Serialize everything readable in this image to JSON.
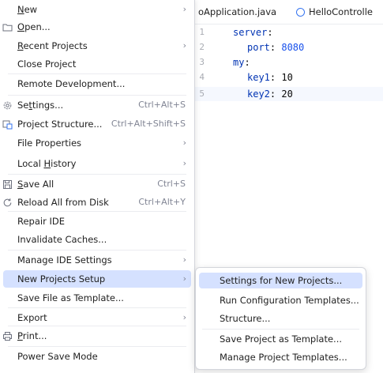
{
  "editor": {
    "tabs": [
      {
        "label": "oApplication.java"
      },
      {
        "label": "HelloControlle"
      }
    ],
    "line_numbers": [
      "1",
      "2",
      "3",
      "4",
      "5"
    ],
    "code": [
      {
        "key": "server",
        "punct": ":",
        "value": ""
      },
      {
        "key": "port",
        "punct": ": ",
        "value": "8080"
      },
      {
        "key": "my",
        "punct": ":",
        "value": ""
      },
      {
        "key": "key1",
        "punct": ": ",
        "value": "10"
      },
      {
        "key": "key2",
        "punct": ": ",
        "value": "20"
      }
    ]
  },
  "menu": {
    "items": [
      {
        "label": "New",
        "underline": "N",
        "shortcut": "",
        "submenu": true,
        "icon": ""
      },
      {
        "label": "Open...",
        "underline": "O",
        "shortcut": "",
        "submenu": false,
        "icon": "folder-icon"
      },
      {
        "label": "Recent Projects",
        "underline": "R",
        "shortcut": "",
        "submenu": true,
        "icon": ""
      },
      {
        "label": "Close Project",
        "underline": "",
        "shortcut": "",
        "submenu": false,
        "icon": ""
      },
      {
        "label": "Remote Development...",
        "underline": "",
        "shortcut": "",
        "submenu": false,
        "icon": ""
      },
      {
        "label": "Settings...",
        "underline": "t",
        "shortcut": "Ctrl+Alt+S",
        "submenu": false,
        "icon": "gear-icon"
      },
      {
        "label": "Project Structure...",
        "underline": "",
        "shortcut": "Ctrl+Alt+Shift+S",
        "submenu": false,
        "icon": "project-structure-icon"
      },
      {
        "label": "File Properties",
        "underline": "",
        "shortcut": "",
        "submenu": true,
        "icon": ""
      },
      {
        "label": "Local History",
        "underline": "H",
        "shortcut": "",
        "submenu": true,
        "icon": ""
      },
      {
        "label": "Save All",
        "underline": "S",
        "shortcut": "Ctrl+S",
        "submenu": false,
        "icon": "save-icon"
      },
      {
        "label": "Reload All from Disk",
        "underline": "",
        "shortcut": "Ctrl+Alt+Y",
        "submenu": false,
        "icon": "reload-icon"
      },
      {
        "label": "Repair IDE",
        "underline": "",
        "shortcut": "",
        "submenu": false,
        "icon": ""
      },
      {
        "label": "Invalidate Caches...",
        "underline": "",
        "shortcut": "",
        "submenu": false,
        "icon": ""
      },
      {
        "label": "Manage IDE Settings",
        "underline": "",
        "shortcut": "",
        "submenu": true,
        "icon": ""
      },
      {
        "label": "New Projects Setup",
        "underline": "",
        "shortcut": "",
        "submenu": true,
        "icon": ""
      },
      {
        "label": "Save File as Template...",
        "underline": "",
        "shortcut": "",
        "submenu": false,
        "icon": ""
      },
      {
        "label": "Export",
        "underline": "",
        "shortcut": "",
        "submenu": true,
        "icon": ""
      },
      {
        "label": "Print...",
        "underline": "P",
        "shortcut": "",
        "submenu": false,
        "icon": "print-icon"
      },
      {
        "label": "Power Save Mode",
        "underline": "",
        "shortcut": "",
        "submenu": false,
        "icon": ""
      }
    ],
    "selected_index": 14
  },
  "submenu": {
    "items": [
      {
        "label": "Settings for New Projects..."
      },
      {
        "label": "Run Configuration Templates..."
      },
      {
        "label": "Structure..."
      },
      {
        "label": "Save Project as Template..."
      },
      {
        "label": "Manage Project Templates..."
      }
    ],
    "selected_index": 0
  },
  "colors": {
    "selection": "#d5e1ff",
    "keyword": "#0033b3",
    "number": "#1750eb",
    "shortcut": "#818594"
  }
}
